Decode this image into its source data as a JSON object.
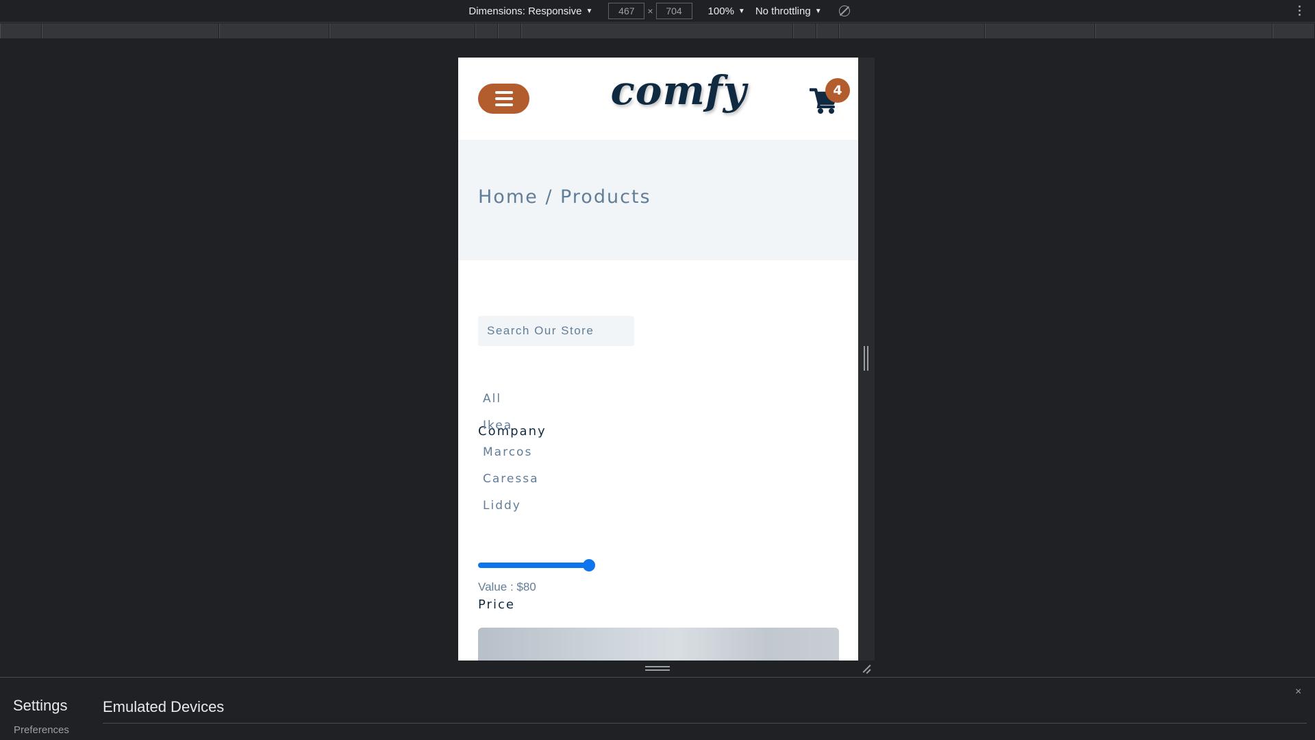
{
  "devtools": {
    "dimensions_label": "Dimensions: Responsive",
    "width_value": "467",
    "height_value": "704",
    "times_sign": "×",
    "zoom_label": "100%",
    "throttling_label": "No throttling",
    "caret": "▼"
  },
  "site": {
    "logo": "comfy",
    "cart_count": "4",
    "breadcrumb": "Home / Products",
    "search_placeholder": "Search Our Store",
    "company_title": "Company",
    "companies": [
      "All",
      "Ikea",
      "Marcos",
      "Caressa",
      "Liddy"
    ],
    "price_title": "Price",
    "price_slider_fraction": 1.0,
    "price_value": "Value : $80",
    "accent_color": "#b35d2f",
    "primary_text_color": "#102a42",
    "muted_text_color": "#617d98"
  },
  "settings_drawer": {
    "title": "Settings",
    "nav_item": "Preferences",
    "heading": "Emulated Devices",
    "close_label": "×"
  },
  "icons": {
    "menu": "hamburger-icon",
    "cart": "shopping-cart-icon",
    "rotate": "rotate-icon",
    "more": "more-vertical-icon"
  }
}
